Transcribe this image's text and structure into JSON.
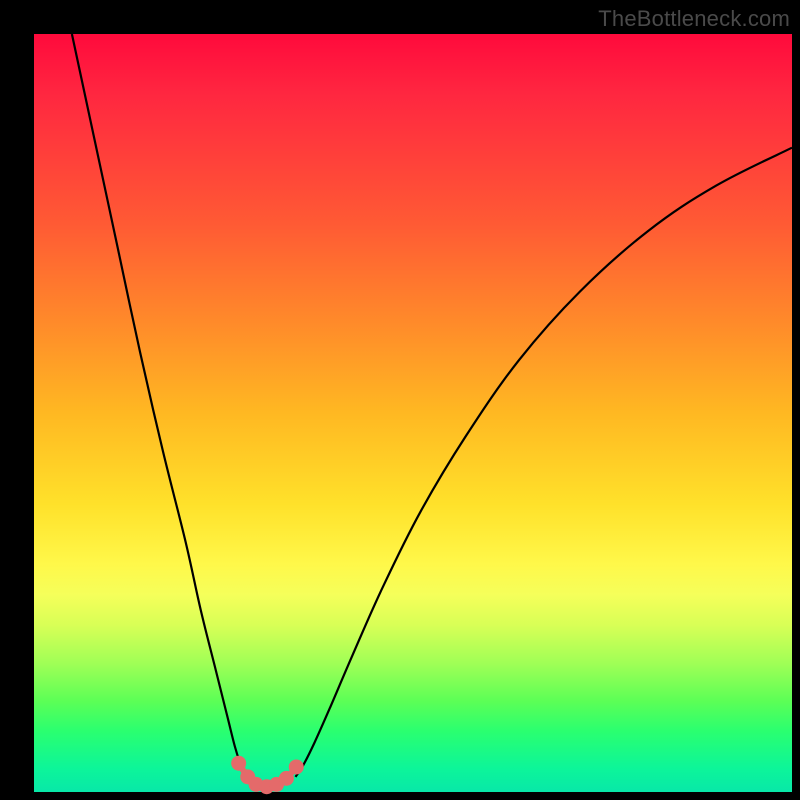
{
  "watermark": "TheBottleneck.com",
  "chart_data": {
    "type": "line",
    "title": "",
    "xlabel": "",
    "ylabel": "",
    "xlim": [
      0,
      100
    ],
    "ylim": [
      0,
      100
    ],
    "series": [
      {
        "name": "left-branch",
        "x": [
          5,
          8,
          11,
          14,
          17,
          20,
          22,
          24,
          25.5,
          26.5,
          27.2,
          27.8,
          28.3
        ],
        "y": [
          100,
          86,
          72,
          58,
          45,
          33,
          24,
          16,
          10,
          6,
          3.8,
          2.4,
          1.6
        ]
      },
      {
        "name": "right-branch",
        "x": [
          34.5,
          35.5,
          37,
          39,
          42,
          46,
          51,
          57,
          64,
          72,
          81,
          90,
          100
        ],
        "y": [
          2.0,
          3.5,
          6.5,
          11,
          18,
          27,
          37,
          47,
          57,
          66,
          74,
          80,
          85
        ]
      },
      {
        "name": "valley-markers",
        "x": [
          27.0,
          28.2,
          29.3,
          30.7,
          32.0,
          33.3,
          34.6
        ],
        "y": [
          3.8,
          2.0,
          1.0,
          0.7,
          1.0,
          1.8,
          3.3
        ]
      }
    ],
    "colors": {
      "curve": "#000000",
      "markers": "#e46a6a"
    }
  }
}
